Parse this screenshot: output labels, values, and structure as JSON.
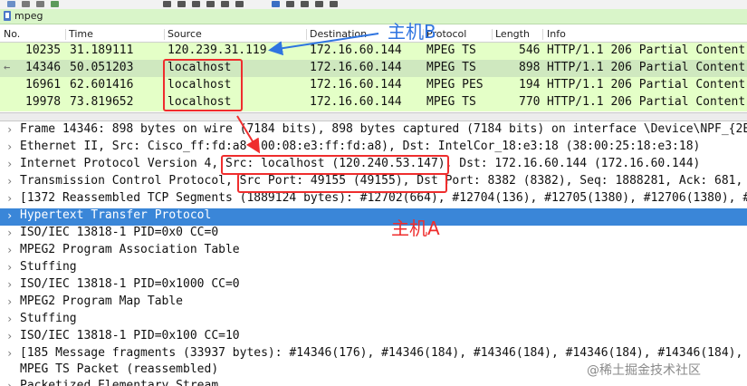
{
  "filter": {
    "value": "mpeg"
  },
  "columns": [
    "No.",
    "Time",
    "Source",
    "Destination",
    "Protocol",
    "Length",
    "Info"
  ],
  "packets": [
    {
      "no": "10235",
      "time": "31.189111",
      "source": "120.239.31.119",
      "destination": "172.16.60.144",
      "protocol": "MPEG TS",
      "length": "546",
      "info": "HTTP/1.1 206 Partial Content"
    },
    {
      "no": "14346",
      "time": "50.051203",
      "source": "localhost",
      "destination": "172.16.60.144",
      "protocol": "MPEG TS",
      "length": "898",
      "info": "HTTP/1.1 206 Partial Content"
    },
    {
      "no": "16961",
      "time": "62.601416",
      "source": "localhost",
      "destination": "172.16.60.144",
      "protocol": "MPEG PES",
      "length": "194",
      "info": "HTTP/1.1 206 Partial Content"
    },
    {
      "no": "19978",
      "time": "73.819652",
      "source": "localhost",
      "destination": "172.16.60.144",
      "protocol": "MPEG TS",
      "length": "770",
      "info": "HTTP/1.1 206 Partial Content"
    }
  ],
  "details": [
    "Frame 14346: 898 bytes on wire (7184 bits), 898 bytes captured (7184 bits) on interface \\Device\\NPF_{2E",
    "Ethernet II, Src: Cisco_ff:fd:a8 (00:08:e3:ff:fd:a8), Dst: IntelCor_18:e3:18 (38:00:25:18:e3:18)",
    "Internet Protocol Version 4, Src: localhost (120.240.53.147), Dst: 172.16.60.144 (172.16.60.144)",
    "Transmission Control Protocol, Src Port: 49155 (49155), Dst Port: 8382 (8382), Seq: 1888281, Ack: 681, L",
    "[1372 Reassembled TCP Segments (1889124 bytes): #12702(664), #12704(136), #12705(1380), #12706(1380), #",
    "Hypertext Transfer Protocol",
    "ISO/IEC 13818-1 PID=0x0 CC=0",
    "MPEG2 Program Association Table",
    "Stuffing",
    "ISO/IEC 13818-1 PID=0x1000 CC=0",
    "MPEG2 Program Map Table",
    "Stuffing",
    "ISO/IEC 13818-1 PID=0x100 CC=10",
    "[185 Message fragments (33937 bytes): #14346(176), #14346(184), #14346(184), #14346(184), #14346(184),",
    "MPEG TS Packet (reassembled)",
    "Packetized Elementary Stream"
  ],
  "annotations": {
    "host_b": "主机B",
    "host_a": "主机A"
  },
  "watermark": "@稀土掘金技术社区",
  "colors": {
    "row_bg": "#e4ffc7",
    "selected_detail": "#3a86d8",
    "annotation_red": "#ef2d2d",
    "annotation_blue": "#2f74e0",
    "filter_bg": "#d9f5c9"
  }
}
